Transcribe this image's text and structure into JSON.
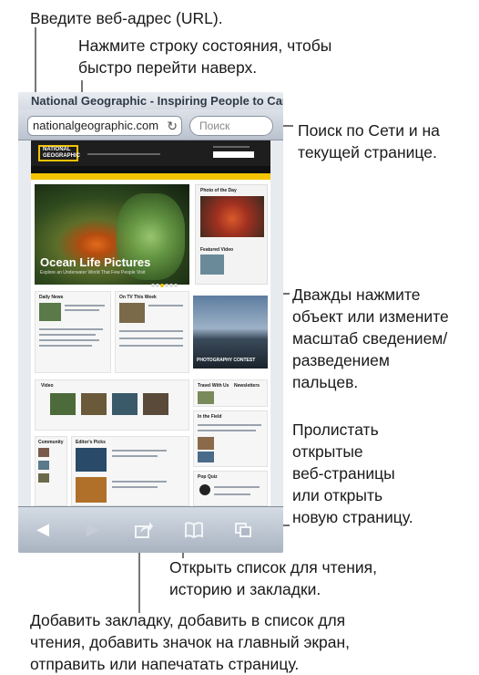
{
  "callouts": {
    "url": "Введите веб-адрес (URL).",
    "status_bar": "Нажмите строку состояния, чтобы\nбыстро перейти наверх.",
    "search": "Поиск по Сети и на\nтекущей странице.",
    "zoom": "Дважды нажмите\nобъект или измените\nмасштаб сведением/\nразведением\nпальцев.",
    "pages": "Пролистать\nоткрытые\nвеб-страницы\nили открыть\nновую страницу.",
    "reading_list": "Открыть список для чтения,\nисторию и закладки.",
    "share": "Добавить закладку, добавить в список для\nчтения, добавить значок на главный экран,\nотправить или напечатать страницу."
  },
  "browser": {
    "page_title": "National Geographic - Inspiring People to Care...",
    "url_value": "nationalgeographic.com",
    "search_placeholder": "Поиск"
  },
  "webpage": {
    "logo": "NATIONAL GEOGRAPHIC",
    "hero_title": "Ocean Life Pictures",
    "hero_subtitle": "Explore an Underwater World That Few People Visit",
    "photo_of_day": "Photo of the Day",
    "featured_video": "Featured Video",
    "daily_news": "Daily News",
    "on_tv": "On TV This Week",
    "video": "Video",
    "travel": "Travel With Us",
    "newsletters": "Newsletters",
    "in_the_field": "In the Field",
    "community": "Community",
    "editors_picks": "Editor's Picks",
    "pop_quiz": "Pop Quiz",
    "ad_caption": "PHOTOGRAPHY CONTEST"
  },
  "toolbar": {
    "back_icon": "back-icon",
    "forward_icon": "forward-icon",
    "share_icon": "share-icon",
    "bookmarks_icon": "bookmarks-icon",
    "pages_icon": "pages-icon"
  }
}
